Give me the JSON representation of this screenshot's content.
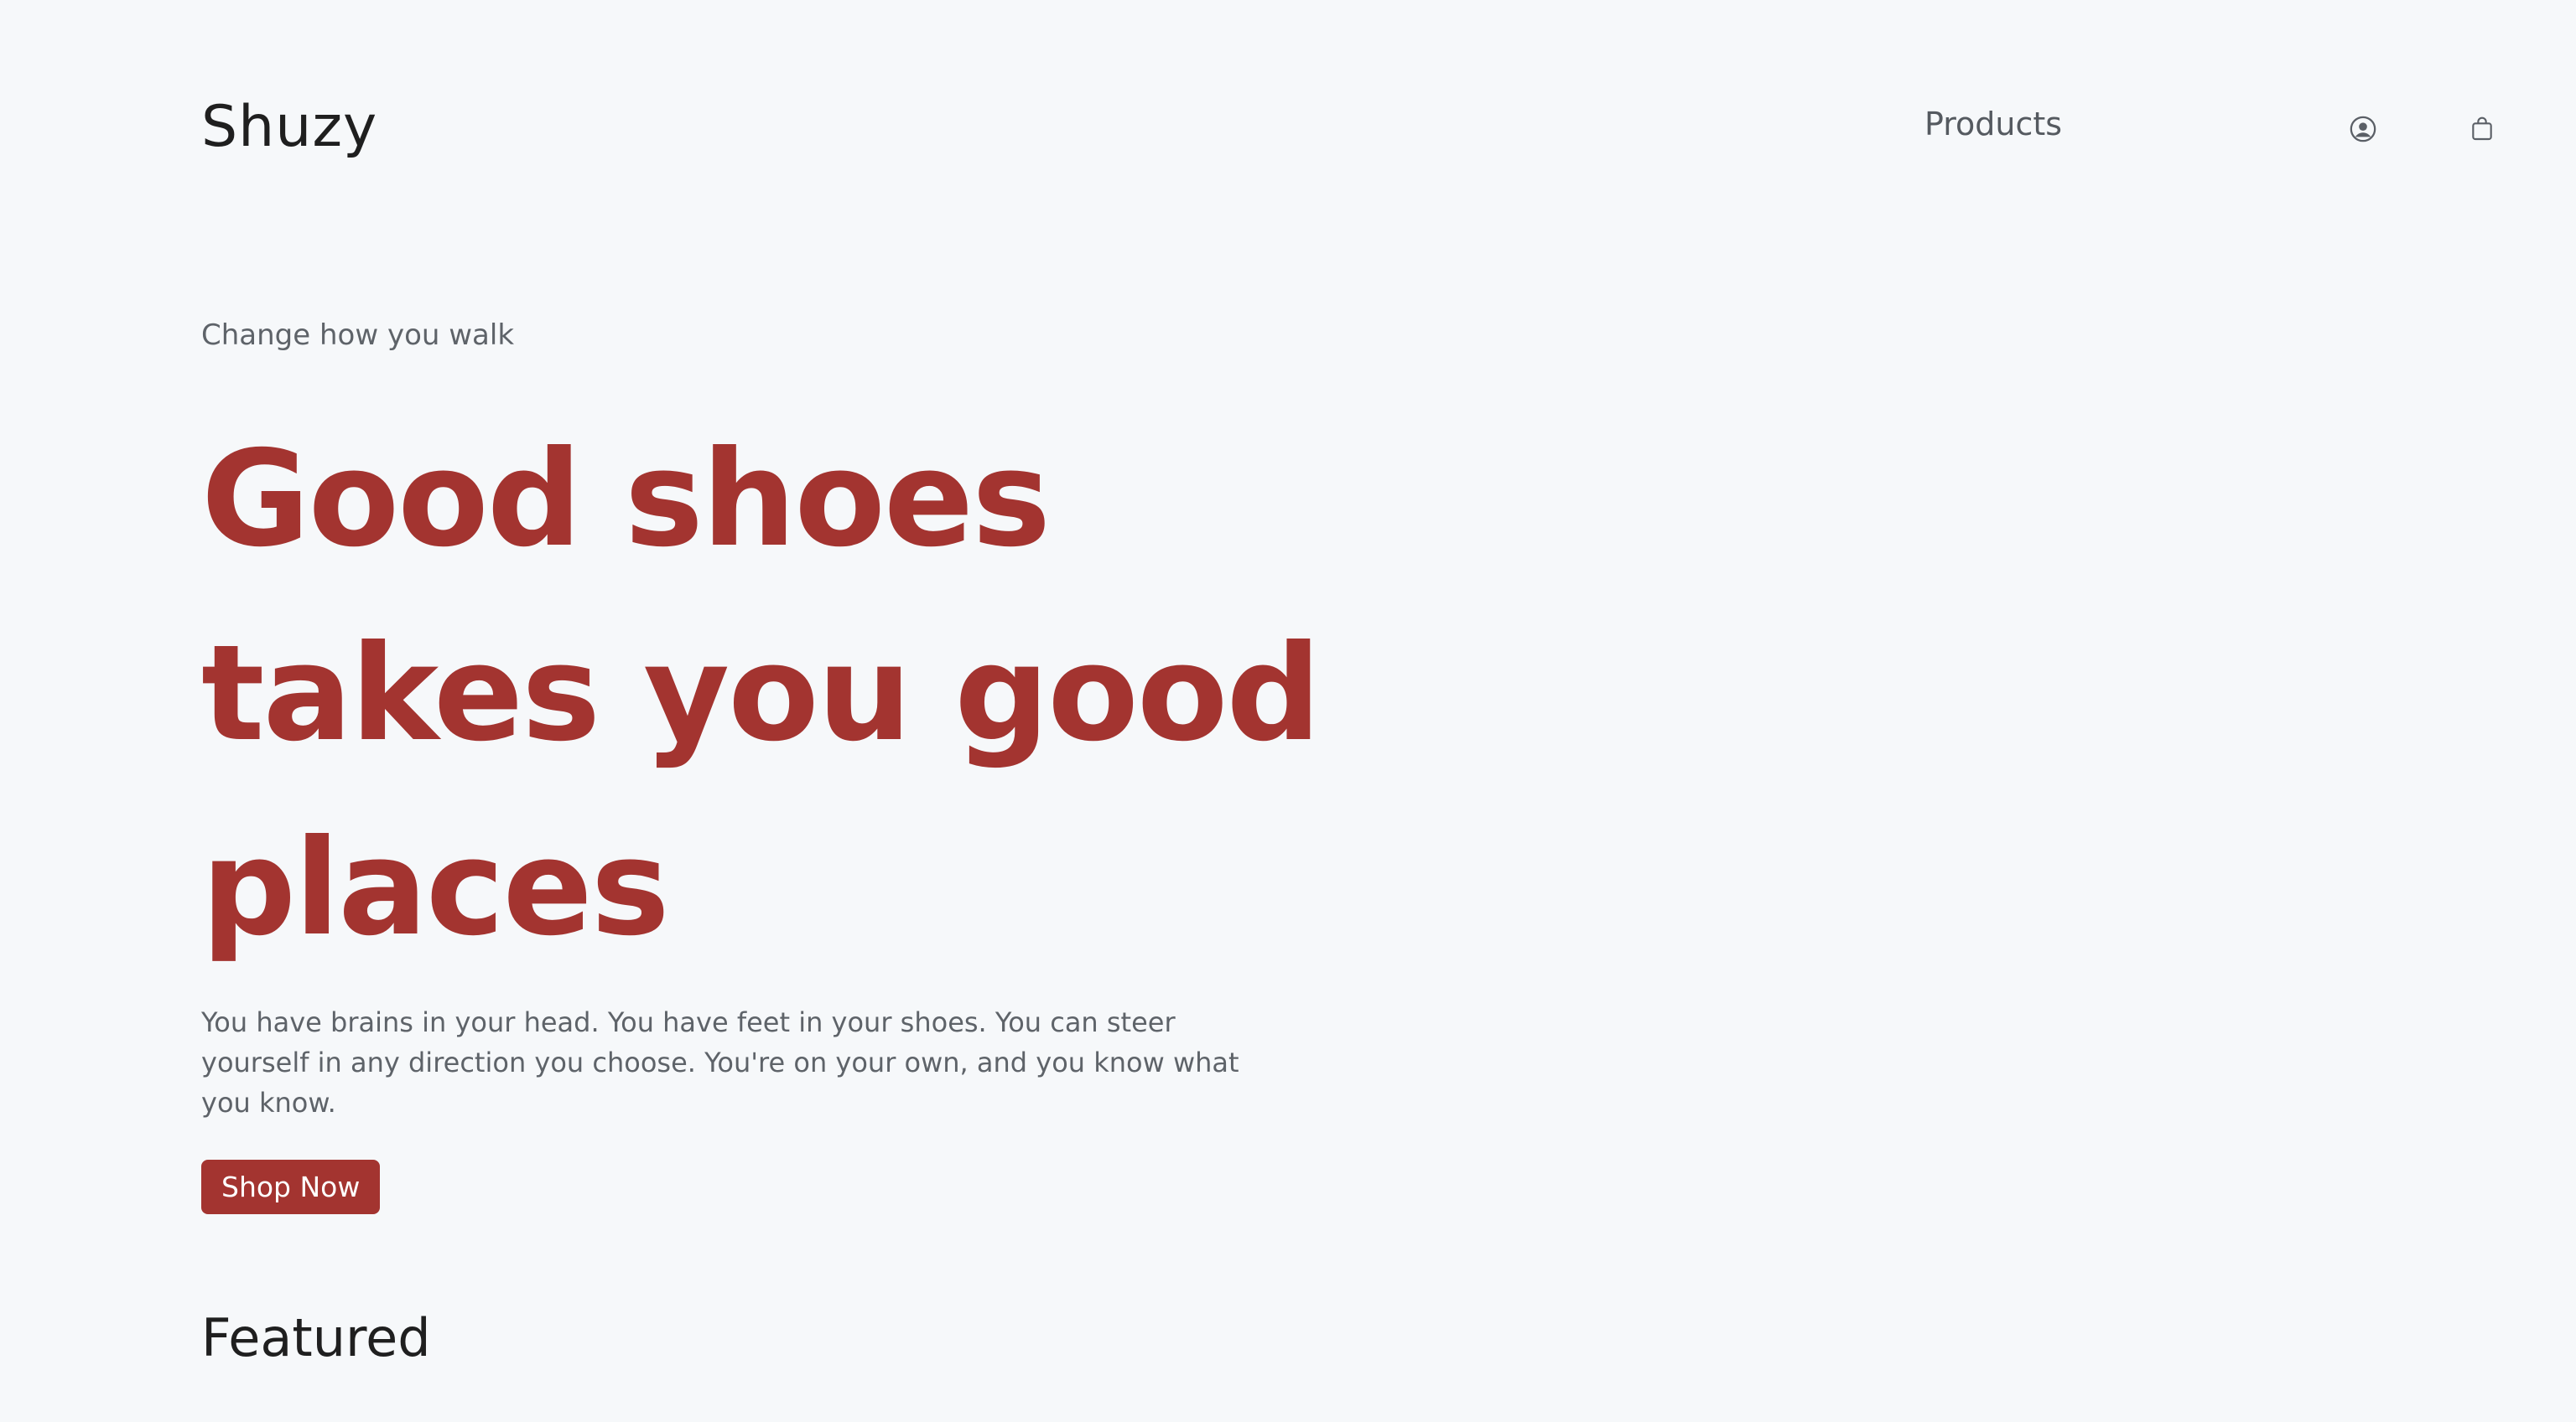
{
  "brand": {
    "name": "Shuzy",
    "accent_color": "#a33430"
  },
  "nav": {
    "products_label": "Products",
    "account_icon": "user-circle-icon",
    "cart_icon": "shopping-bag-icon"
  },
  "hero": {
    "tagline": "Change how you walk",
    "headline_lines": [
      "Good shoes",
      "takes you good",
      "places"
    ],
    "description": "You have brains in your head. You have feet in your shoes. You can steer yourself in any direction you choose. You're on your own, and you know what you know.",
    "cta_label": "Shop Now"
  },
  "sections": {
    "featured_title": "Featured"
  }
}
